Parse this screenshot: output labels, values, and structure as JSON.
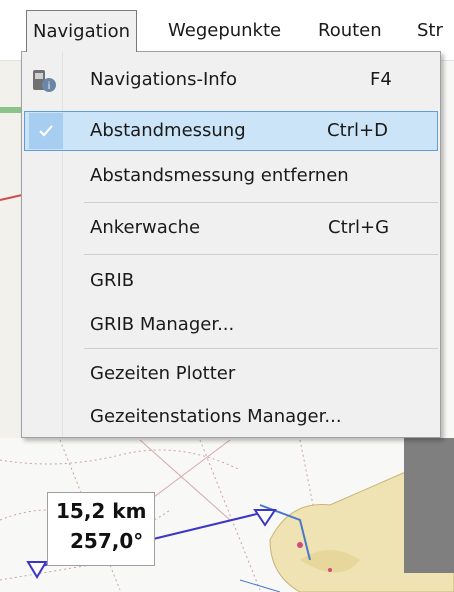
{
  "menubar": {
    "items": [
      "Navigation",
      "Wegepunkte",
      "Routen",
      "Str"
    ],
    "active_index": 0
  },
  "dropdown": {
    "items": [
      {
        "label": "Navigations-Info",
        "shortcut": "F4",
        "icon": "navigation-info-icon",
        "checked": false,
        "highlighted": false
      },
      {
        "label": "Abstandmessung",
        "shortcut": "Ctrl+D",
        "icon": "checkmark-icon",
        "checked": true,
        "highlighted": true
      },
      {
        "label": "Abstandsmessung entfernen",
        "shortcut": "",
        "icon": "",
        "checked": false,
        "highlighted": false
      },
      {
        "label": "Ankerwache",
        "shortcut": "Ctrl+G",
        "icon": "",
        "checked": false,
        "highlighted": false
      },
      {
        "label": "GRIB",
        "shortcut": "",
        "icon": "",
        "checked": false,
        "highlighted": false
      },
      {
        "label": "GRIB Manager...",
        "shortcut": "",
        "icon": "",
        "checked": false,
        "highlighted": false
      },
      {
        "label": "Gezeiten Plotter",
        "shortcut": "",
        "icon": "",
        "checked": false,
        "highlighted": false
      },
      {
        "label": "Gezeitenstations Manager...",
        "shortcut": "",
        "icon": "",
        "checked": false,
        "highlighted": false
      }
    ]
  },
  "measurement": {
    "distance": "15,2 km",
    "bearing": "257,0°"
  },
  "colors": {
    "highlight_bg": "#cce4f7",
    "highlight_border": "#5f9ed9",
    "check_bg": "#a7cdf0",
    "measure_line": "#3b36c8",
    "land": "#f2e6b9",
    "water": "#f7f7f7"
  }
}
